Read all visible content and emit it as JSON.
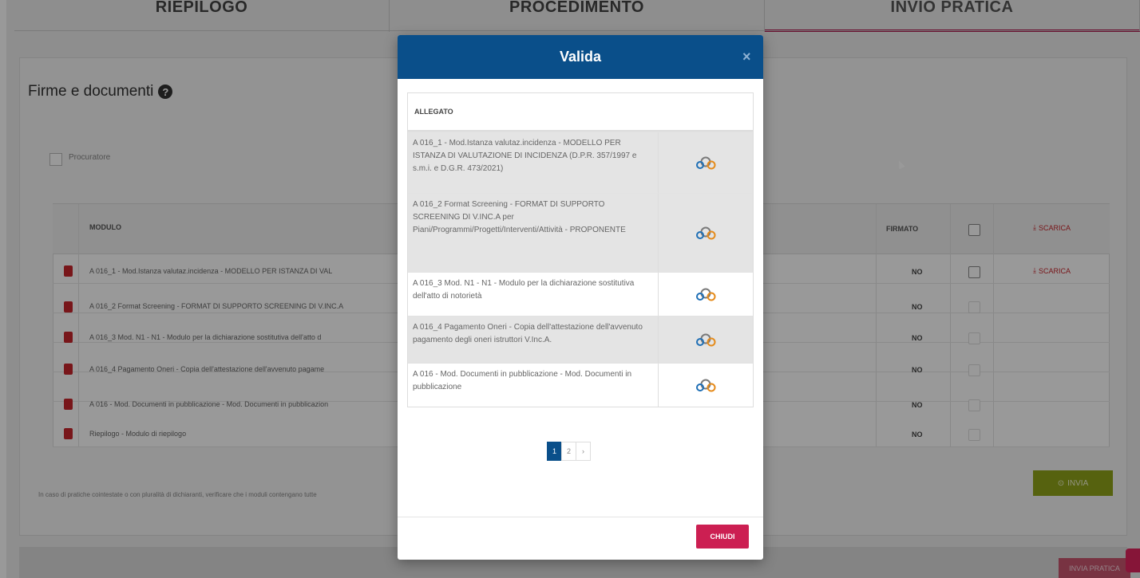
{
  "tabs": [
    {
      "label": "RIEPILOGO"
    },
    {
      "label": "PROCEDIMENTO"
    },
    {
      "label": "INVIO PRATICA"
    }
  ],
  "section": {
    "title": "Firme e documenti",
    "procuratore_label": "Procuratore",
    "note": "In caso di pratiche cointestate o con pluralità di dichiaranti, verificare che i moduli contengano tutte"
  },
  "table": {
    "col_modulo": "MODULO",
    "col_firmato": "FIRMATO",
    "scarica_label": "SCARICA",
    "rows": [
      {
        "text": "A 016_1 - Mod.Istanza valutaz.incidenza - MODELLO PER ISTANZA DI VAL",
        "firmato": "NO"
      },
      {
        "text": "A 016_2 Format Screening - FORMAT DI SUPPORTO SCREENING DI V.INC.A",
        "firmato": "NO"
      },
      {
        "text": "A 016_3 Mod. N1 - N1 - Modulo per la dichiarazione sostitutiva dell'atto d",
        "firmato": "NO"
      },
      {
        "text": "A 016_4 Pagamento Oneri - Copia dell'attestazione dell'avvenuto pagame",
        "firmato": "NO"
      },
      {
        "text": "A 016 - Mod. Documenti in pubblicazione - Mod. Documenti in pubblicazion",
        "firmato": "NO"
      },
      {
        "text": "Riepilogo - Modulo di riepilogo",
        "firmato": "NO"
      }
    ],
    "invia_label": "INVIA"
  },
  "footer": {
    "button_label": "INVIA PRATICA"
  },
  "modal": {
    "title": "Valida",
    "close_glyph": "×",
    "column_header": "ALLEGATO",
    "rows": [
      {
        "desc": "A 016_1 - Mod.Istanza valutaz.incidenza - MODELLO PER ISTANZA DI VALUTAZIONE DI INCIDENZA (D.P.R. 357/1997 e s.m.i. e D.G.R. 473/2021)",
        "icon": "link-icon"
      },
      {
        "desc": "A 016_2 Format Screening - FORMAT DI SUPPORTO SCREENING DI V.INC.A per Piani/Programmi/Progetti/Interventi/Attività - PROPONENTE",
        "icon": "link-icon"
      },
      {
        "desc": "A 016_3 Mod. N1 - N1 - Modulo per la dichiarazione sostitutiva dell'atto di notorietà",
        "icon": "link-icon"
      },
      {
        "desc": "A 016_4 Pagamento Oneri - Copia dell'attestazione dell'avvenuto pagamento degli oneri istruttori V.Inc.A.",
        "icon": "link-icon"
      },
      {
        "desc": "A 016 - Mod. Documenti in pubblicazione - Mod. Documenti in pubblicazione",
        "icon": "link-icon"
      }
    ],
    "pagination": {
      "pages": [
        "1",
        "2"
      ],
      "next": "›",
      "current": "1"
    },
    "close_button_label": "CHIUDI"
  },
  "colors": {
    "brand_blue": "#0a4f8a",
    "close_red": "#cc1f52",
    "invia_green": "#8fa31a",
    "pdf_red": "#c9252c"
  }
}
